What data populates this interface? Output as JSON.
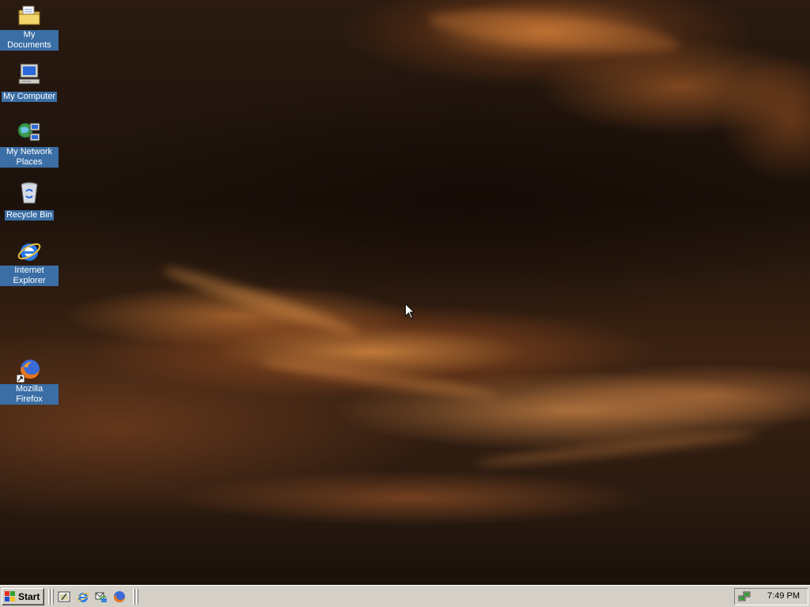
{
  "desktop": {
    "icons": [
      {
        "label": "My Documents"
      },
      {
        "label": "My Computer"
      },
      {
        "label": "My Network Places"
      },
      {
        "label": "Recycle Bin"
      },
      {
        "label": "Internet Explorer"
      },
      {
        "label": "Mozilla Firefox"
      }
    ]
  },
  "taskbar": {
    "start_label": "Start",
    "quick_launch": [
      "show-desktop-icon",
      "internet-explorer-icon",
      "outlook-express-icon",
      "firefox-icon"
    ],
    "clock": "7:49 PM"
  },
  "colors": {
    "taskbar": "#d4d0c8",
    "icon_label_bg": "#3a6ea5"
  }
}
